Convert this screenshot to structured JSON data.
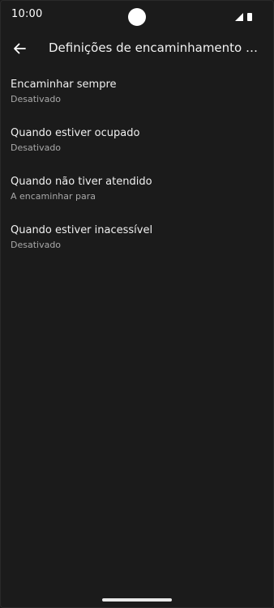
{
  "status_bar": {
    "time": "10:00",
    "icons": [
      "signal-icon",
      "battery-icon"
    ]
  },
  "app_bar": {
    "back_icon": "arrow-left-icon",
    "title": "Definições de encaminhamento de ch…"
  },
  "settings": {
    "items": [
      {
        "title": "Encaminhar sempre",
        "summary": "Desativado"
      },
      {
        "title": "Quando estiver ocupado",
        "summary": "Desativado"
      },
      {
        "title": "Quando não tiver atendido",
        "summary": "A encaminhar para"
      },
      {
        "title": "Quando estiver inacessível",
        "summary": "Desativado"
      }
    ]
  },
  "colors": {
    "background": "#1b1b1b",
    "primary_text": "#f0f0f0",
    "secondary_text": "#a8a8a8"
  }
}
